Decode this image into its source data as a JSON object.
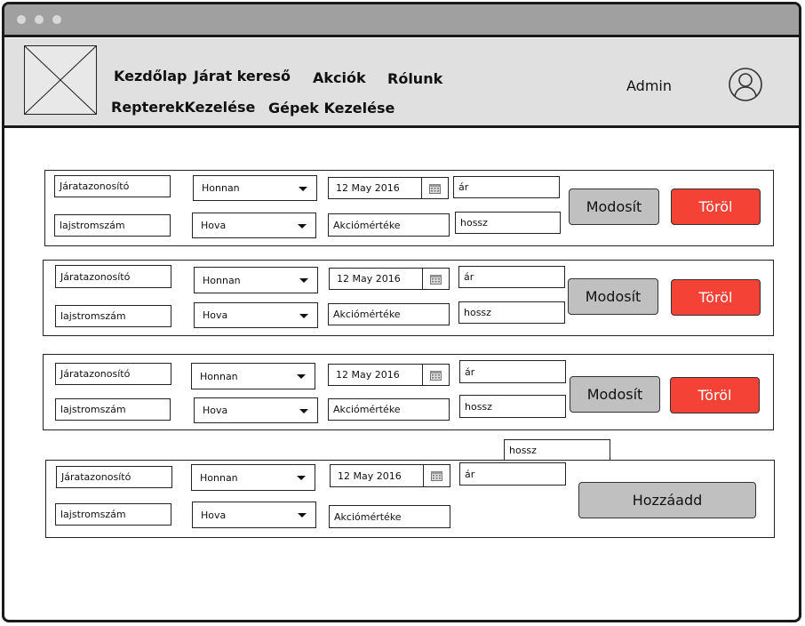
{
  "nav": {
    "home": "Kezdőlap",
    "flight_search": "Járat kereső",
    "deals": "Akciók",
    "about": "Rólunk",
    "airports": "RepterekKezelése",
    "planes": "Gépek Kezelése",
    "user": "Admin"
  },
  "labels": {
    "flight_id": "Járatazonosító",
    "registration": "lajstromszám",
    "from": "Honnan",
    "to": "Hova",
    "date": "12 May 2016",
    "discount": "Akciómértéke",
    "price": "ár",
    "length": "hossz",
    "modify": "Modosít",
    "delete": "Töröl",
    "add": "Hozzáadd"
  }
}
